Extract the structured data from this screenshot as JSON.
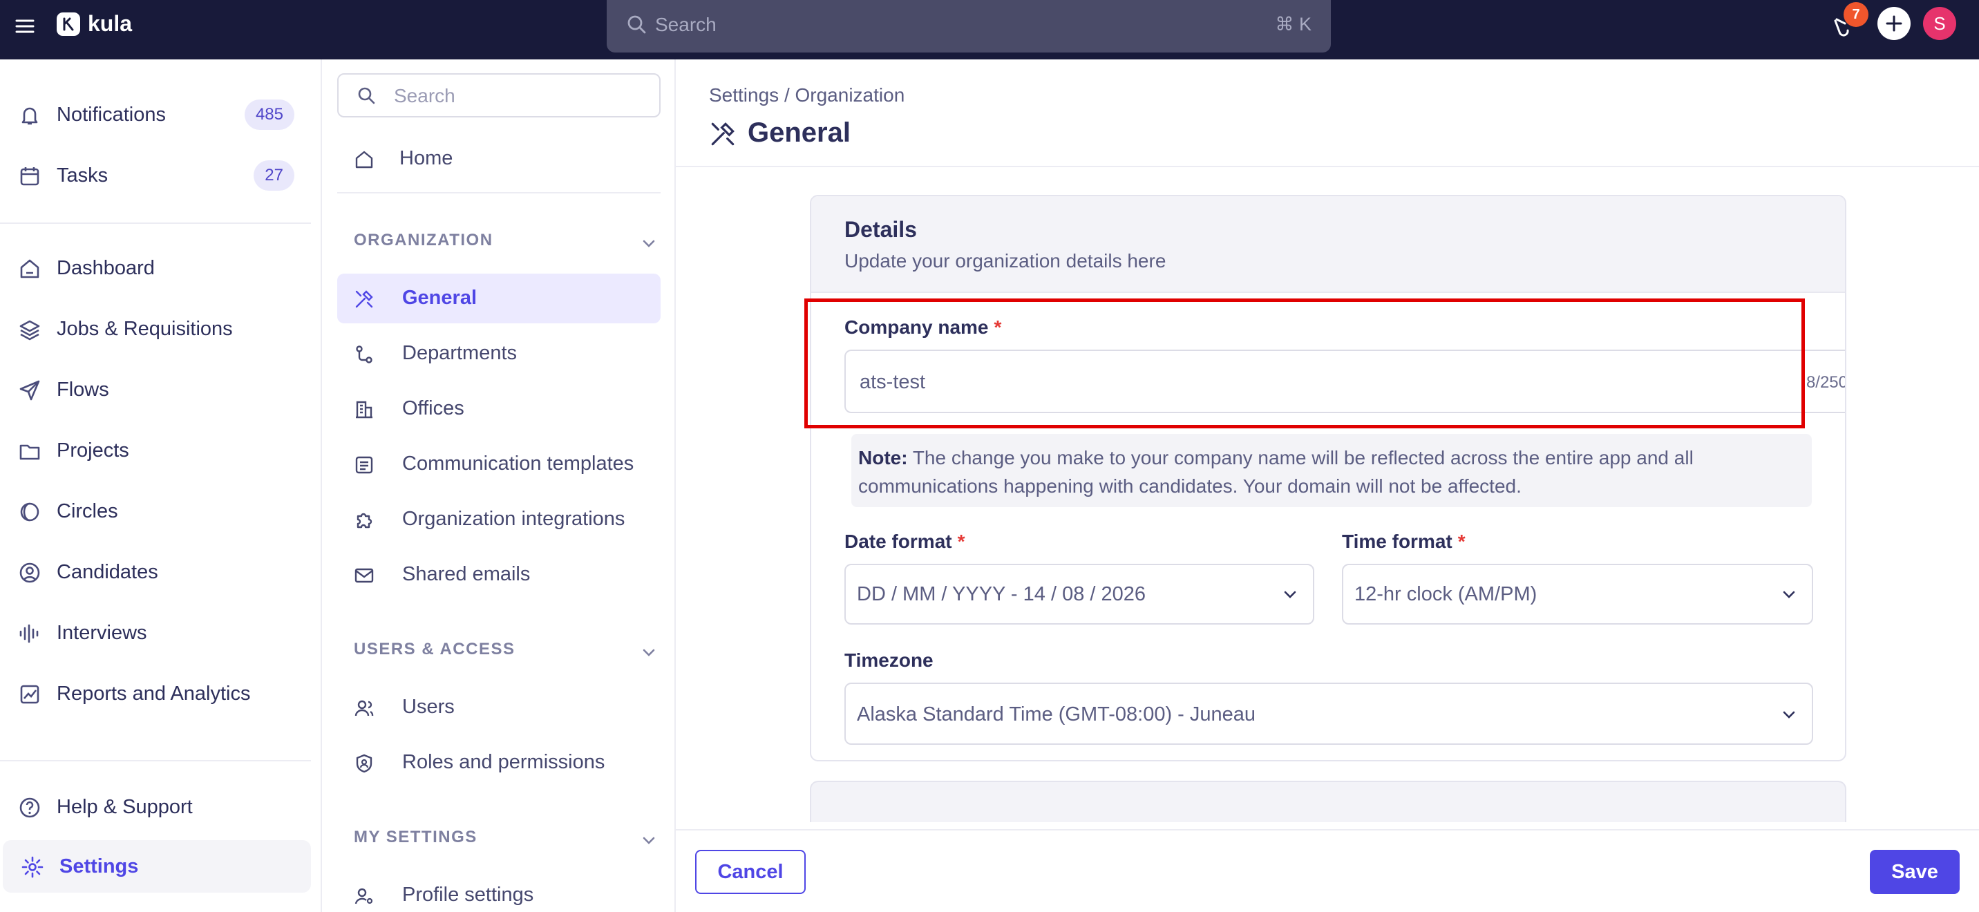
{
  "topbar": {
    "logo_text": "kula",
    "search_placeholder": "Search",
    "search_shortcut": "⌘ K",
    "notifications_badge": "7",
    "avatar_initial": "S"
  },
  "leftnav": {
    "items": [
      {
        "label": "Notifications",
        "count": "485",
        "icon": "bell-icon"
      },
      {
        "label": "Tasks",
        "count": "27",
        "icon": "calendar-icon"
      },
      {
        "label": "Dashboard",
        "icon": "home-icon"
      },
      {
        "label": "Jobs & Requisitions",
        "icon": "layers-icon"
      },
      {
        "label": "Flows",
        "icon": "send-icon"
      },
      {
        "label": "Projects",
        "icon": "folder-icon"
      },
      {
        "label": "Circles",
        "icon": "circles-icon"
      },
      {
        "label": "Candidates",
        "icon": "user-circle-icon"
      },
      {
        "label": "Interviews",
        "icon": "waveform-icon"
      },
      {
        "label": "Reports and Analytics",
        "icon": "chart-icon"
      },
      {
        "label": "Help & Support",
        "icon": "help-icon"
      },
      {
        "label": "Settings",
        "icon": "gear-icon"
      }
    ]
  },
  "subnav": {
    "search_placeholder": "Search",
    "home_label": "Home",
    "sections": [
      {
        "title": "ORGANIZATION",
        "items": [
          "General",
          "Departments",
          "Offices",
          "Communication templates",
          "Organization integrations",
          "Shared emails"
        ]
      },
      {
        "title": "USERS & ACCESS",
        "items": [
          "Users",
          "Roles and permissions"
        ]
      },
      {
        "title": "MY SETTINGS",
        "items": [
          "Profile settings"
        ]
      }
    ]
  },
  "main": {
    "breadcrumb": "Settings / Organization",
    "title": "General",
    "card": {
      "title": "Details",
      "subtitle": "Update your organization details here",
      "company_name_label": "Company name",
      "required_mark": "*",
      "company_name_value": "ats-test",
      "company_name_counter": "8/250",
      "note_label": "Note:",
      "note_text": " The change you make to your company name will be reflected across the entire app and all communications happening with candidates. Your domain will not be affected.",
      "date_format_label": "Date format",
      "date_format_value": "DD / MM / YYYY - 14 / 08 / 2026",
      "time_format_label": "Time format",
      "time_format_value": "12-hr clock (AM/PM)",
      "timezone_label": "Timezone",
      "timezone_value": "Alaska Standard Time (GMT-08:00) - Juneau"
    },
    "footer": {
      "cancel_label": "Cancel",
      "save_label": "Save"
    }
  },
  "colors": {
    "topbar_bg": "#181a3a",
    "accent": "#4f46e5",
    "highlight": "#e00000",
    "badge": "#f0562c",
    "avatar": "#e6336c"
  }
}
